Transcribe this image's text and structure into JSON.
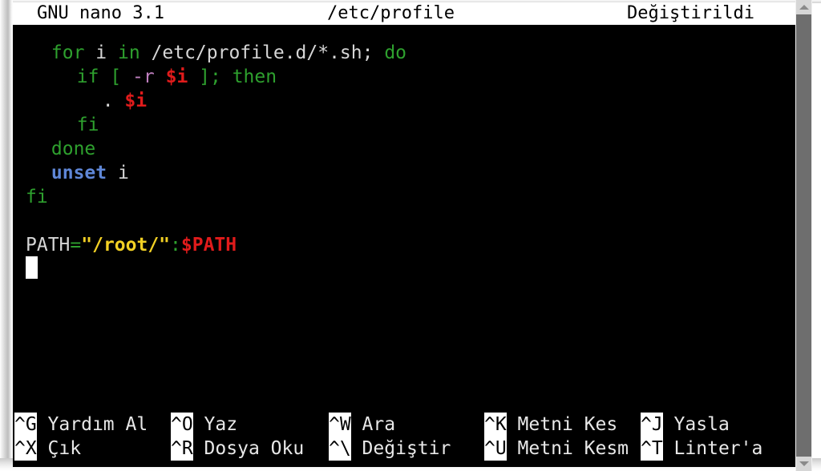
{
  "app": {
    "name": "GNU nano",
    "version_label": "GNU nano 3.1",
    "filename": "/etc/profile",
    "state_label": "Değiştirildi"
  },
  "editor": {
    "lines": [
      {
        "index": 0,
        "indent": 2,
        "tokens": [
          {
            "text": "for",
            "kind": "kw"
          },
          {
            "text": " i ",
            "kind": "plain"
          },
          {
            "text": "in",
            "kind": "kw"
          },
          {
            "text": " /etc/profile.d/*.sh; ",
            "kind": "plain"
          },
          {
            "text": "do",
            "kind": "kw"
          }
        ]
      },
      {
        "index": 1,
        "indent": 4,
        "tokens": [
          {
            "text": "if [ ",
            "kind": "kw"
          },
          {
            "text": "-r",
            "kind": "flag"
          },
          {
            "text": " ",
            "kind": "plain"
          },
          {
            "text": "$i",
            "kind": "var"
          },
          {
            "text": " ]; ",
            "kind": "kw"
          },
          {
            "text": "then",
            "kind": "kw"
          }
        ]
      },
      {
        "index": 2,
        "indent": 6,
        "tokens": [
          {
            "text": ". ",
            "kind": "plain"
          },
          {
            "text": "$i",
            "kind": "var"
          }
        ]
      },
      {
        "index": 3,
        "indent": 4,
        "tokens": [
          {
            "text": "fi",
            "kind": "kw"
          }
        ]
      },
      {
        "index": 4,
        "indent": 2,
        "tokens": [
          {
            "text": "done",
            "kind": "kw"
          }
        ]
      },
      {
        "index": 5,
        "indent": 2,
        "tokens": [
          {
            "text": "unset",
            "kind": "kw-blue"
          },
          {
            "text": " i",
            "kind": "plain"
          }
        ]
      },
      {
        "index": 6,
        "indent": 0,
        "tokens": [
          {
            "text": "fi",
            "kind": "kw"
          }
        ]
      },
      {
        "index": 7,
        "indent": 0,
        "tokens": []
      },
      {
        "index": 8,
        "indent": 0,
        "tokens": [
          {
            "text": "PATH",
            "kind": "plain"
          },
          {
            "text": "=",
            "kind": "op"
          },
          {
            "text": "\"/root/\"",
            "kind": "str"
          },
          {
            "text": ":",
            "kind": "op"
          },
          {
            "text": "$PATH",
            "kind": "var"
          }
        ]
      }
    ],
    "cursor": {
      "line": 9,
      "column": 0
    }
  },
  "helpbar": {
    "rows": [
      [
        {
          "key": "^G",
          "label": " Yardım Al"
        },
        {
          "key": "^O",
          "label": " Yaz"
        },
        {
          "key": "^W",
          "label": " Ara"
        },
        {
          "key": "^K",
          "label": " Metni Kes"
        },
        {
          "key": "^J",
          "label": " Yasla"
        }
      ],
      [
        {
          "key": "^X",
          "label": " Çık"
        },
        {
          "key": "^R",
          "label": " Dosya Oku"
        },
        {
          "key": "^\\",
          "label": " Değiştir"
        },
        {
          "key": "^U",
          "label": " Metni Kesm"
        },
        {
          "key": "^T",
          "label": " Linter'a"
        }
      ]
    ]
  },
  "scrollbar": {
    "up_arrow": "scroll-up-arrow",
    "down_arrow": "scroll-down-arrow"
  },
  "colors": {
    "background": "#000000",
    "foreground": "#d6d6d6",
    "keyword_green": "#2ea02e",
    "keyword_blue": "#5f87d7",
    "variable_red": "#e01b1b",
    "string_yellow": "#f2d024",
    "flag_magenta": "#c080c0",
    "titlebar_bg": "#ffffff",
    "titlebar_fg": "#000000"
  }
}
